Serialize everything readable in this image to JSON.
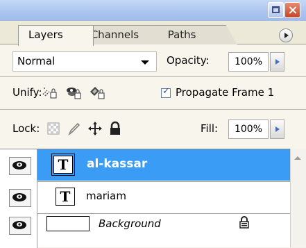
{
  "panel": {
    "tabs": [
      {
        "label": "Layers",
        "active": true
      },
      {
        "label": "Channels",
        "active": false
      },
      {
        "label": "Paths",
        "active": false
      }
    ]
  },
  "blend": {
    "mode": "Normal",
    "opacity_label": "Opacity:",
    "opacity_value": "100%"
  },
  "unify": {
    "label": "Unify:",
    "propagate_label": "Propagate Frame 1",
    "propagate_checked": true
  },
  "lock": {
    "label": "Lock:",
    "fill_label": "Fill:",
    "fill_value": "100%"
  },
  "layers": [
    {
      "name": "al-kassar",
      "type": "text",
      "visible": true,
      "selected": true,
      "thumb_glyph": "T"
    },
    {
      "name": "mariam",
      "type": "text",
      "visible": true,
      "selected": false,
      "thumb_glyph": "T"
    },
    {
      "name": "Background",
      "type": "image",
      "visible": true,
      "selected": false,
      "locked": true
    }
  ],
  "colors": {
    "selection": "#3b9cf5",
    "titlebar": "#a9c4ee",
    "close": "#c9442a"
  }
}
